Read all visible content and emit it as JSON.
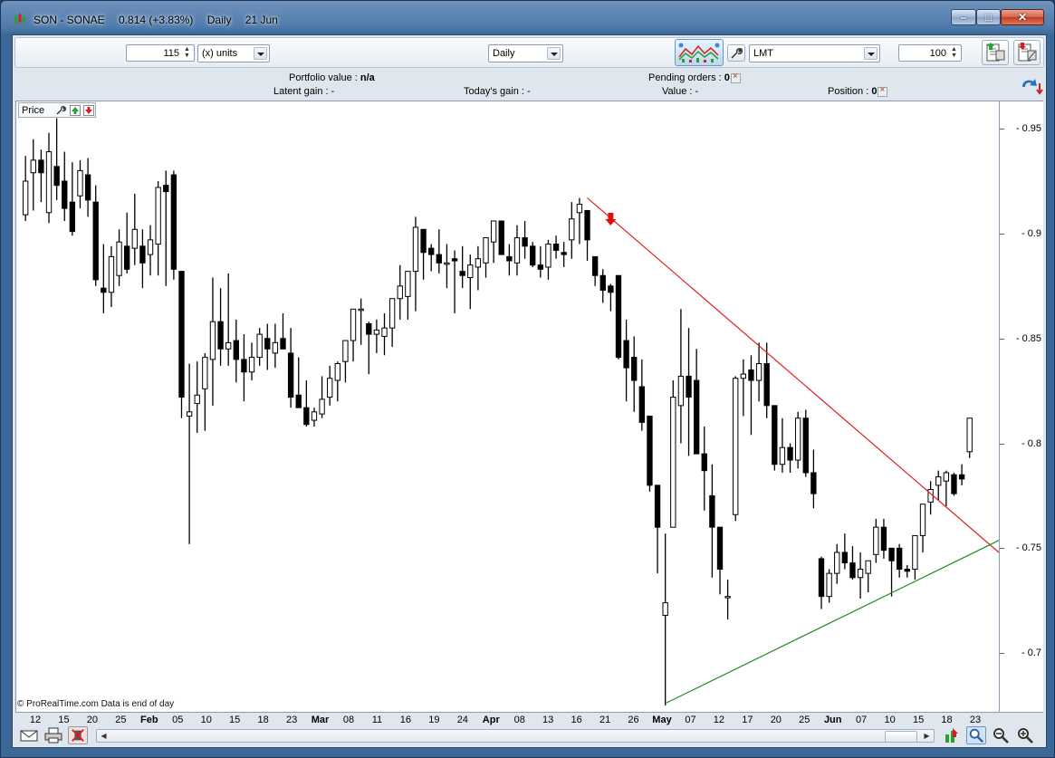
{
  "window": {
    "instrument": "SON - SONAE",
    "price": "0.814 (+3.83%)",
    "period": "Daily",
    "date": "21 Jun",
    "controls": {
      "minimize": "–",
      "maximize": "□",
      "close": "✕"
    }
  },
  "toolbar": {
    "quantity": "115",
    "quantity_unit": "(x) units",
    "timeframe": "Daily",
    "order_type": "LMT",
    "order_qty": "100"
  },
  "info": {
    "portfolio_label": "Portfolio value : ",
    "portfolio_value": "n/a",
    "pending_label": "Pending orders : ",
    "pending_value": "0",
    "latent_label": "Latent gain : ",
    "latent_value": "-",
    "today_label": "Today's gain : ",
    "today_value": "-",
    "value_label": "Value : ",
    "value_value": "-",
    "position_label": "Position : ",
    "position_value": "0"
  },
  "panel": {
    "label": "Price",
    "copyright": "© ProRealTime.com  Data is end of day"
  },
  "colors": {
    "bullish": "#ffffff",
    "bearish": "#000000",
    "resistance_line": "#e02020",
    "support_line": "#1f8a1f",
    "sell_arrow": "#e01010"
  },
  "icons": [
    "app-candles-icon",
    "indicator-chart-icon",
    "wrench-icon",
    "buy-ticket-icon",
    "sell-ticket-icon",
    "refresh-arrows-icon",
    "mail-icon",
    "printer-icon",
    "mute-icon",
    "tool-icon",
    "zoom-select-icon",
    "zoom-out-icon",
    "zoom-in-icon"
  ],
  "chart_data": {
    "type": "candlestick",
    "y_axis": {
      "ticks": [
        "0.95",
        "0.9",
        "0.85",
        "0.8",
        "0.75",
        "0.7"
      ],
      "range": [
        0.672,
        0.963
      ]
    },
    "x_axis": {
      "ticks": [
        {
          "label": "12",
          "month": false
        },
        {
          "label": "15",
          "month": false
        },
        {
          "label": "20",
          "month": false
        },
        {
          "label": "25",
          "month": false
        },
        {
          "label": "Feb",
          "month": true
        },
        {
          "label": "05",
          "month": false
        },
        {
          "label": "10",
          "month": false
        },
        {
          "label": "15",
          "month": false
        },
        {
          "label": "18",
          "month": false
        },
        {
          "label": "23",
          "month": false
        },
        {
          "label": "Mar",
          "month": true
        },
        {
          "label": "08",
          "month": false
        },
        {
          "label": "11",
          "month": false
        },
        {
          "label": "16",
          "month": false
        },
        {
          "label": "19",
          "month": false
        },
        {
          "label": "24",
          "month": false
        },
        {
          "label": "Apr",
          "month": true
        },
        {
          "label": "08",
          "month": false
        },
        {
          "label": "13",
          "month": false
        },
        {
          "label": "16",
          "month": false
        },
        {
          "label": "21",
          "month": false
        },
        {
          "label": "26",
          "month": false
        },
        {
          "label": "May",
          "month": true
        },
        {
          "label": "07",
          "month": false
        },
        {
          "label": "12",
          "month": false
        },
        {
          "label": "17",
          "month": false
        },
        {
          "label": "20",
          "month": false
        },
        {
          "label": "25",
          "month": false
        },
        {
          "label": "Jun",
          "month": true
        },
        {
          "label": "07",
          "month": false
        },
        {
          "label": "10",
          "month": false
        },
        {
          "label": "15",
          "month": false
        },
        {
          "label": "18",
          "month": false
        },
        {
          "label": "23",
          "month": false
        }
      ]
    },
    "candles": [
      [
        0.909,
        0.937,
        0.906,
        0.925
      ],
      [
        0.929,
        0.945,
        0.911,
        0.935
      ],
      [
        0.935,
        0.94,
        0.915,
        0.929
      ],
      [
        0.91,
        0.948,
        0.905,
        0.939
      ],
      [
        0.932,
        0.955,
        0.916,
        0.923
      ],
      [
        0.925,
        0.939,
        0.906,
        0.912
      ],
      [
        0.915,
        0.934,
        0.899,
        0.901
      ],
      [
        0.918,
        0.935,
        0.912,
        0.93
      ],
      [
        0.928,
        0.936,
        0.908,
        0.916
      ],
      [
        0.915,
        0.923,
        0.875,
        0.878
      ],
      [
        0.874,
        0.895,
        0.862,
        0.872
      ],
      [
        0.872,
        0.894,
        0.865,
        0.889
      ],
      [
        0.88,
        0.902,
        0.875,
        0.896
      ],
      [
        0.894,
        0.91,
        0.881,
        0.883
      ],
      [
        0.893,
        0.919,
        0.885,
        0.902
      ],
      [
        0.894,
        0.902,
        0.874,
        0.886
      ],
      [
        0.89,
        0.904,
        0.88,
        0.897
      ],
      [
        0.895,
        0.925,
        0.88,
        0.922
      ],
      [
        0.923,
        0.93,
        0.875,
        0.92
      ],
      [
        0.928,
        0.93,
        0.878,
        0.883
      ],
      [
        0.882,
        0.882,
        0.812,
        0.822
      ],
      [
        0.813,
        0.838,
        0.752,
        0.815
      ],
      [
        0.819,
        0.839,
        0.805,
        0.823
      ],
      [
        0.826,
        0.843,
        0.806,
        0.841
      ],
      [
        0.84,
        0.879,
        0.818,
        0.858
      ],
      [
        0.858,
        0.874,
        0.837,
        0.845
      ],
      [
        0.845,
        0.881,
        0.837,
        0.848
      ],
      [
        0.849,
        0.859,
        0.829,
        0.84
      ],
      [
        0.84,
        0.852,
        0.82,
        0.834
      ],
      [
        0.834,
        0.848,
        0.83,
        0.841
      ],
      [
        0.841,
        0.855,
        0.837,
        0.852
      ],
      [
        0.85,
        0.857,
        0.835,
        0.845
      ],
      [
        0.843,
        0.857,
        0.836,
        0.848
      ],
      [
        0.85,
        0.862,
        0.845,
        0.845
      ],
      [
        0.843,
        0.855,
        0.817,
        0.822
      ],
      [
        0.823,
        0.841,
        0.817,
        0.817
      ],
      [
        0.817,
        0.83,
        0.808,
        0.809
      ],
      [
        0.811,
        0.817,
        0.808,
        0.815
      ],
      [
        0.814,
        0.832,
        0.812,
        0.821
      ],
      [
        0.822,
        0.837,
        0.818,
        0.831
      ],
      [
        0.83,
        0.839,
        0.82,
        0.838
      ],
      [
        0.839,
        0.849,
        0.829,
        0.849
      ],
      [
        0.849,
        0.86,
        0.839,
        0.864
      ],
      [
        0.864,
        0.869,
        0.847,
        0.864
      ],
      [
        0.857,
        0.858,
        0.833,
        0.852
      ],
      [
        0.852,
        0.859,
        0.843,
        0.854
      ],
      [
        0.851,
        0.862,
        0.842,
        0.855
      ],
      [
        0.855,
        0.865,
        0.846,
        0.869
      ],
      [
        0.869,
        0.885,
        0.859,
        0.875
      ],
      [
        0.87,
        0.882,
        0.859,
        0.882
      ],
      [
        0.882,
        0.908,
        0.863,
        0.903
      ],
      [
        0.902,
        0.897,
        0.878,
        0.891
      ],
      [
        0.893,
        0.895,
        0.882,
        0.89
      ],
      [
        0.89,
        0.902,
        0.881,
        0.886
      ],
      [
        0.886,
        0.895,
        0.874,
        0.886
      ],
      [
        0.888,
        0.892,
        0.862,
        0.887
      ],
      [
        0.882,
        0.894,
        0.874,
        0.88
      ],
      [
        0.879,
        0.89,
        0.864,
        0.885
      ],
      [
        0.884,
        0.894,
        0.873,
        0.888
      ],
      [
        0.886,
        0.896,
        0.879,
        0.898
      ],
      [
        0.896,
        0.906,
        0.886,
        0.906
      ],
      [
        0.906,
        0.903,
        0.894,
        0.89
      ],
      [
        0.889,
        0.895,
        0.88,
        0.887
      ],
      [
        0.886,
        0.904,
        0.88,
        0.898
      ],
      [
        0.898,
        0.906,
        0.888,
        0.894
      ],
      [
        0.894,
        0.896,
        0.884,
        0.885
      ],
      [
        0.885,
        0.894,
        0.879,
        0.883
      ],
      [
        0.884,
        0.897,
        0.878,
        0.895
      ],
      [
        0.895,
        0.899,
        0.888,
        0.892
      ],
      [
        0.891,
        0.896,
        0.884,
        0.89
      ],
      [
        0.897,
        0.915,
        0.888,
        0.907
      ],
      [
        0.91,
        0.917,
        0.895,
        0.914
      ],
      [
        0.911,
        0.907,
        0.887,
        0.897
      ],
      [
        0.889,
        0.882,
        0.875,
        0.88
      ],
      [
        0.88,
        0.883,
        0.867,
        0.873
      ],
      [
        0.875,
        0.876,
        0.863,
        0.872
      ],
      [
        0.88,
        0.88,
        0.84,
        0.841
      ],
      [
        0.849,
        0.859,
        0.82,
        0.836
      ],
      [
        0.841,
        0.851,
        0.815,
        0.83
      ],
      [
        0.827,
        0.84,
        0.806,
        0.81
      ],
      [
        0.813,
        0.808,
        0.777,
        0.78
      ],
      [
        0.78,
        0.742,
        0.738,
        0.76
      ],
      [
        0.718,
        0.757,
        0.675,
        0.724
      ],
      [
        0.76,
        0.83,
        0.8,
        0.822
      ],
      [
        0.818,
        0.864,
        0.8,
        0.832
      ],
      [
        0.832,
        0.855,
        0.794,
        0.822
      ],
      [
        0.83,
        0.845,
        0.795,
        0.795
      ],
      [
        0.795,
        0.808,
        0.768,
        0.787
      ],
      [
        0.775,
        0.79,
        0.736,
        0.76
      ],
      [
        0.76,
        0.748,
        0.728,
        0.74
      ],
      [
        0.727,
        0.735,
        0.716,
        0.727
      ],
      [
        0.766,
        0.832,
        0.763,
        0.831
      ],
      [
        0.831,
        0.84,
        0.813,
        0.833
      ],
      [
        0.835,
        0.842,
        0.804,
        0.83
      ],
      [
        0.83,
        0.848,
        0.82,
        0.838
      ],
      [
        0.838,
        0.848,
        0.812,
        0.818
      ],
      [
        0.818,
        0.818,
        0.787,
        0.79
      ],
      [
        0.79,
        0.812,
        0.786,
        0.798
      ],
      [
        0.798,
        0.8,
        0.786,
        0.792
      ],
      [
        0.792,
        0.815,
        0.788,
        0.812
      ],
      [
        0.812,
        0.816,
        0.784,
        0.786
      ],
      [
        0.786,
        0.797,
        0.769,
        0.776
      ],
      [
        0.745,
        0.746,
        0.721,
        0.727
      ],
      [
        0.727,
        0.74,
        0.724,
        0.738
      ],
      [
        0.738,
        0.752,
        0.733,
        0.748
      ],
      [
        0.748,
        0.757,
        0.74,
        0.743
      ],
      [
        0.743,
        0.751,
        0.735,
        0.736
      ],
      [
        0.736,
        0.748,
        0.726,
        0.74
      ],
      [
        0.738,
        0.744,
        0.729,
        0.744
      ],
      [
        0.747,
        0.764,
        0.743,
        0.76
      ],
      [
        0.76,
        0.764,
        0.745,
        0.749
      ],
      [
        0.75,
        0.743,
        0.727,
        0.744
      ],
      [
        0.75,
        0.752,
        0.736,
        0.74
      ],
      [
        0.74,
        0.742,
        0.736,
        0.739
      ],
      [
        0.74,
        0.752,
        0.735,
        0.756
      ],
      [
        0.756,
        0.769,
        0.748,
        0.771
      ],
      [
        0.772,
        0.782,
        0.766,
        0.778
      ],
      [
        0.78,
        0.787,
        0.773,
        0.784
      ],
      [
        0.782,
        0.787,
        0.77,
        0.786
      ],
      [
        0.785,
        0.786,
        0.775,
        0.776
      ],
      [
        0.785,
        0.79,
        0.78,
        0.783
      ],
      [
        0.796,
        0.809,
        0.793,
        0.812
      ]
    ],
    "trendlines": [
      {
        "name": "resistance",
        "color": "#e02020",
        "from": [
          72,
          0.917
        ],
        "to": [
          126,
          0.744
        ]
      },
      {
        "name": "support",
        "color": "#1f8a1f",
        "from": [
          82,
          0.676
        ],
        "to": [
          126,
          0.756
        ]
      }
    ],
    "sell_arrow_at": {
      "index": 75,
      "price": 0.906
    }
  }
}
